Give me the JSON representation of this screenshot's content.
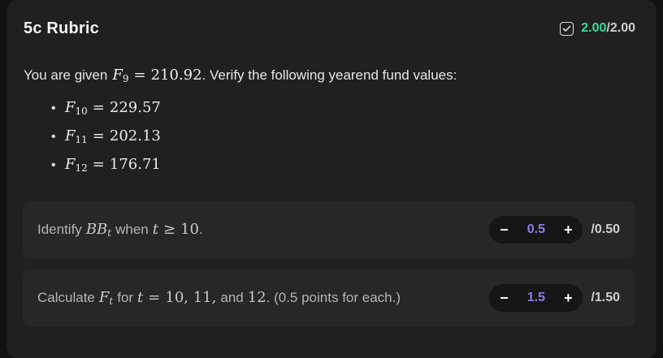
{
  "card": {
    "title": "5c Rubric",
    "score_earned": "2.00",
    "score_sep": "/",
    "score_total": "2.00",
    "check_icon": "checkbox-check-icon"
  },
  "intro": {
    "prefix": "You are given",
    "var": "F",
    "sub": "9",
    "eq": "=",
    "value": "210.92",
    "suffix": ". Verify the following yearend fund values:"
  },
  "funds": [
    {
      "var": "F",
      "sub": "10",
      "eq": "=",
      "value": "229.57"
    },
    {
      "var": "F",
      "sub": "11",
      "eq": "=",
      "value": "202.13"
    },
    {
      "var": "F",
      "sub": "12",
      "eq": "=",
      "value": "176.71"
    }
  ],
  "criteria": [
    {
      "t1": "Identify",
      "m1": "BB",
      "m1_sub": "t",
      "t2": "when",
      "m2": "t",
      "m2_op": "≥",
      "m2_val": "10",
      "t3": ".",
      "minus": "−",
      "value": "0.5",
      "plus": "+",
      "max": "/0.50"
    },
    {
      "t1": "Calculate",
      "m1": "F",
      "m1_sub": "t",
      "t2": "for",
      "m2": "t",
      "m2_op": "=",
      "m2_val": "10, 11,",
      "t3": "and",
      "m3": "12",
      "t4": ". (0.5 points for each.)",
      "minus": "−",
      "value": "1.5",
      "plus": "+",
      "max": "/1.50"
    }
  ],
  "colors": {
    "accent_green": "#3fd69b",
    "accent_purple": "#8a7fe6"
  }
}
